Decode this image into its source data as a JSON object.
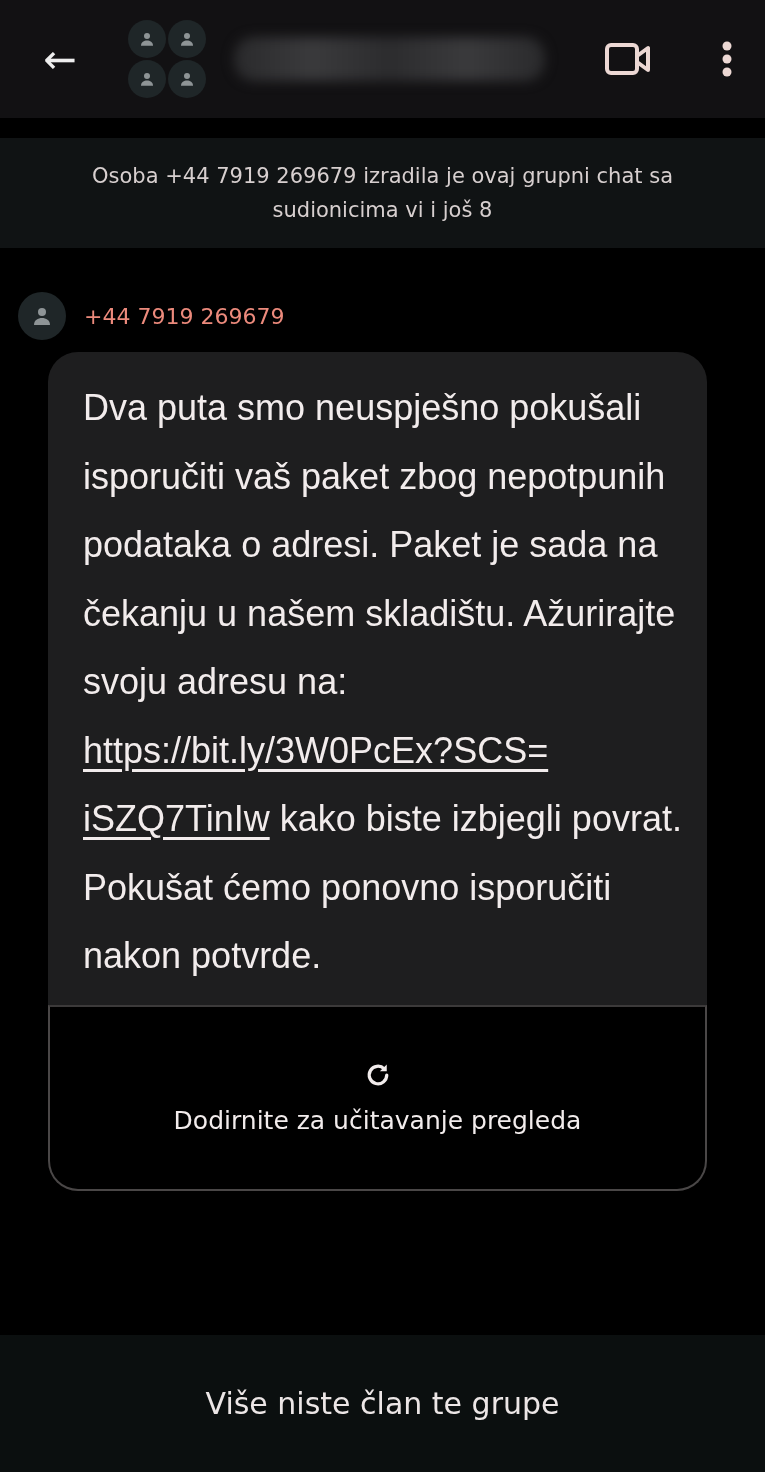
{
  "header": {
    "back": "←"
  },
  "banner": {
    "text": "Osoba +44 7919 269679 izradila je ovaj grupni chat sa sudionicima vi i još 8"
  },
  "message": {
    "sender": "+44 7919 269679",
    "text_before": "Dva puta smo neuspješno pokušali isporučiti vaš paket zbog nepotpunih podataka o adresi. Paket je sada na čekanju u našem skladištu. Ažurirajte svoju adresu na:",
    "link_lines": [
      "https://bit.ly/3W0PcEx?SCS=",
      "iSZQ7TinIw"
    ],
    "text_after": "kako biste izbjegli povrat. Pokušat ćemo ponovno isporučiti nakon potvrde.",
    "preview": {
      "label": "Dodirnite za učitavanje pregleda"
    }
  },
  "footer": {
    "text": "Više niste član te grupe"
  }
}
